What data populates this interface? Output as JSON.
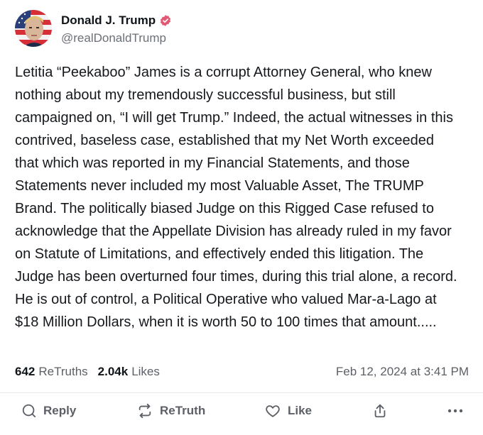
{
  "author": {
    "display_name": "Donald J. Trump",
    "handle": "@realDonaldTrump",
    "verified_color": "#e05a74"
  },
  "post": {
    "text": "Letitia “Peekaboo” James is a corrupt Attorney General, who knew nothing about my tremendously successful business, but still campaigned on, “I will get Trump.” Indeed, the actual witnesses in this contrived, baseless case, established that my Net Worth exceeded that which was reported in my Financial Statements, and those Statements never included my most Valuable Asset, The TRUMP Brand. The politically biased Judge on this Rigged Case refused to acknowledge that the Appellate Division has already ruled in my favor on Statute of Limitations, and effectively ended this litigation. The Judge has been overturned four times, during this trial alone, a record. He is out of control, a Political Operative who valued Mar-a-Lago at $18 Million Dollars, when it is worth 50 to 100 times that amount.....",
    "retruths_count": "642",
    "retruths_label": "ReTruths",
    "likes_count": "2.04k",
    "likes_label": "Likes",
    "timestamp": "Feb 12, 2024 at 3:41 PM"
  },
  "actions": {
    "reply_label": "Reply",
    "retruth_label": "ReTruth",
    "like_label": "Like"
  },
  "icons": [
    "avatar",
    "verified-badge-icon",
    "reply-icon",
    "retruth-icon",
    "like-icon",
    "share-icon",
    "more-icon"
  ]
}
